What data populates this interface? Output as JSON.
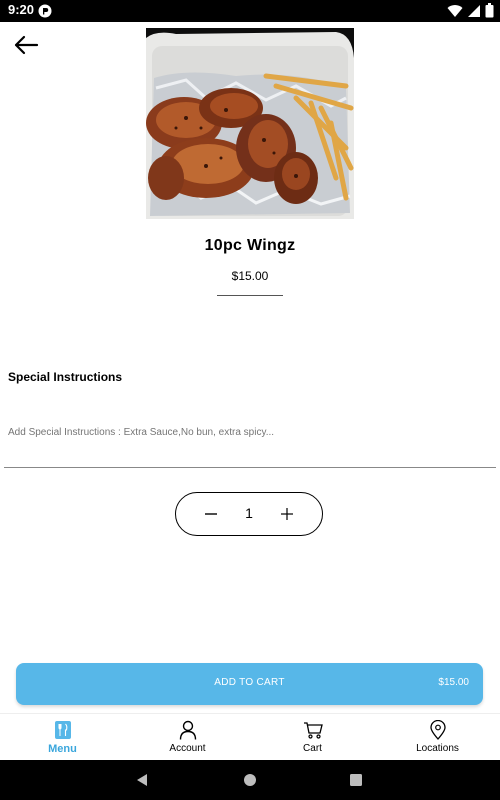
{
  "status_bar": {
    "time": "9:20"
  },
  "product": {
    "title": "10pc Wingz",
    "price": "$15.00",
    "image_alt": "wings and fries in foil container"
  },
  "special_instructions": {
    "heading": "Special Instructions",
    "placeholder": "Add Special Instructions : Extra Sauce,No bun, extra spicy..."
  },
  "quantity": {
    "value": "1"
  },
  "add_to_cart": {
    "label": "ADD TO CART",
    "price": "$15.00"
  },
  "bottom_nav": {
    "items": [
      {
        "label": "Menu",
        "icon": "menu-fork-knife-icon",
        "active": true
      },
      {
        "label": "Account",
        "icon": "person-icon",
        "active": false
      },
      {
        "label": "Cart",
        "icon": "cart-icon",
        "active": false
      },
      {
        "label": "Locations",
        "icon": "map-pin-icon",
        "active": false
      }
    ]
  },
  "colors": {
    "accent": "#57b7e8",
    "nav_active": "#3aa6dc",
    "system_bar": "#000000"
  }
}
